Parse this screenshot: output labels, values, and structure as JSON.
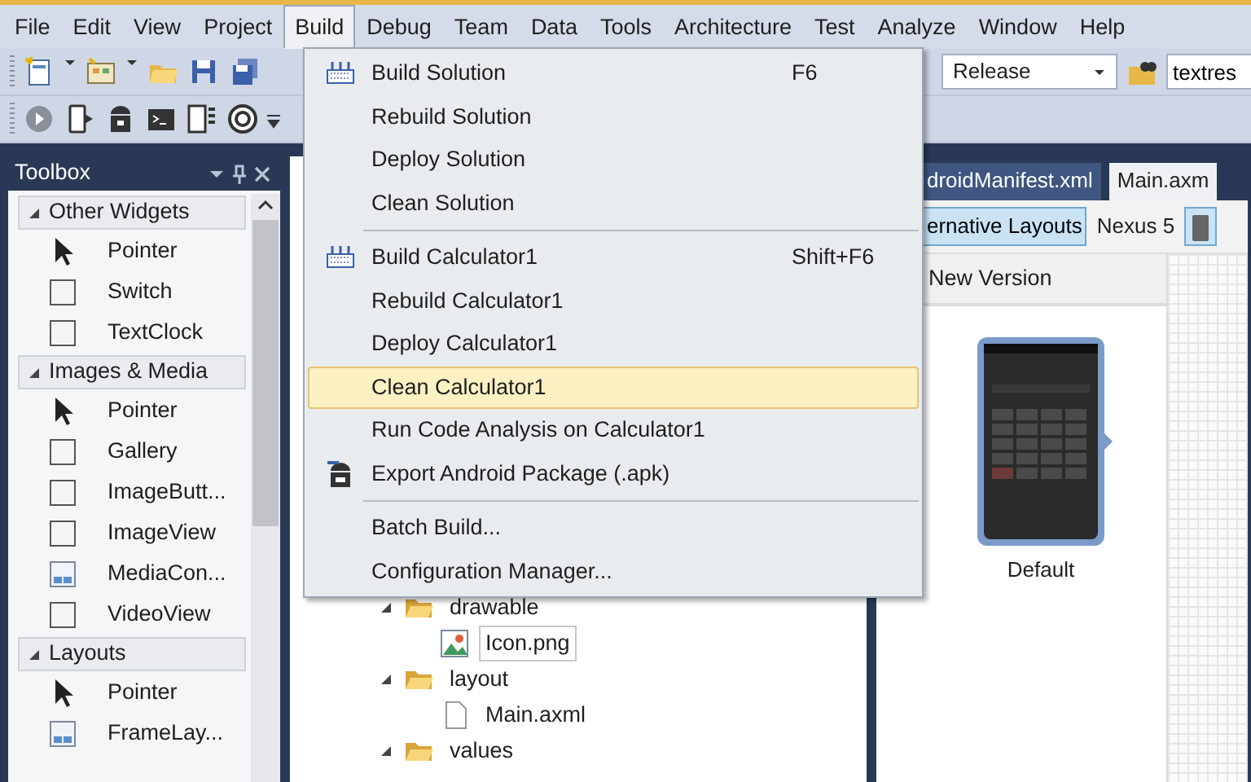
{
  "menu_bar": [
    {
      "label": "File",
      "selected": false
    },
    {
      "label": "Edit",
      "selected": false
    },
    {
      "label": "View",
      "selected": false
    },
    {
      "label": "Project",
      "selected": false
    },
    {
      "label": "Build",
      "selected": true
    },
    {
      "label": "Debug",
      "selected": false
    },
    {
      "label": "Team",
      "selected": false
    },
    {
      "label": "Data",
      "selected": false
    },
    {
      "label": "Tools",
      "selected": false
    },
    {
      "label": "Architecture",
      "selected": false
    },
    {
      "label": "Test",
      "selected": false
    },
    {
      "label": "Analyze",
      "selected": false
    },
    {
      "label": "Window",
      "selected": false
    },
    {
      "label": "Help",
      "selected": false
    }
  ],
  "toolbar": {
    "configuration": "Release",
    "find_value": "textres"
  },
  "toolbox": {
    "title": "Toolbox",
    "groups": [
      {
        "label": "Other Widgets",
        "expanded": true,
        "items": [
          {
            "label": "Pointer",
            "kind": "pointer"
          },
          {
            "label": "Switch",
            "kind": "control"
          },
          {
            "label": "TextClock",
            "kind": "control"
          }
        ]
      },
      {
        "label": "Images & Media",
        "expanded": true,
        "items": [
          {
            "label": "Pointer",
            "kind": "pointer"
          },
          {
            "label": "Gallery",
            "kind": "control"
          },
          {
            "label": "ImageButt...",
            "kind": "control"
          },
          {
            "label": "ImageView",
            "kind": "control"
          },
          {
            "label": "MediaCon...",
            "kind": "form"
          },
          {
            "label": "VideoView",
            "kind": "control"
          }
        ]
      },
      {
        "label": "Layouts",
        "expanded": true,
        "items": [
          {
            "label": "Pointer",
            "kind": "pointer"
          },
          {
            "label": "FrameLay...",
            "kind": "form"
          }
        ]
      }
    ]
  },
  "solution_tree": [
    {
      "label": "drawable",
      "kind": "folder",
      "expanded": true,
      "children": [
        {
          "label": "Icon.png",
          "kind": "image",
          "focused": true
        }
      ]
    },
    {
      "label": "layout",
      "kind": "folder",
      "expanded": true,
      "children": [
        {
          "label": "Main.axml",
          "kind": "file"
        }
      ]
    },
    {
      "label": "values",
      "kind": "folder",
      "expanded": true
    }
  ],
  "designer": {
    "tabs": [
      {
        "label": "droidManifest.xml",
        "selected": false
      },
      {
        "label": "Main.axm",
        "selected": true
      }
    ],
    "alternative_layouts": {
      "label": "ernative Layouts",
      "on": true
    },
    "device": "Nexus 5",
    "version_header": "New Version",
    "preview_label": "Default"
  },
  "build_menu": {
    "sections": [
      [
        {
          "label": "Build Solution",
          "shortcut": "F6",
          "kind": "build",
          "selected": false
        },
        {
          "label": "Rebuild Solution",
          "selected": false
        },
        {
          "label": "Deploy Solution",
          "selected": false
        },
        {
          "label": "Clean Solution",
          "selected": false
        }
      ],
      [
        {
          "label": "Build Calculator1",
          "shortcut": "Shift+F6",
          "kind": "build",
          "selected": false
        },
        {
          "label": "Rebuild Calculator1",
          "selected": false
        },
        {
          "label": "Deploy Calculator1",
          "selected": false
        },
        {
          "label": "Clean Calculator1",
          "selected": true
        },
        {
          "label": "Run Code Analysis on Calculator1",
          "selected": false
        },
        {
          "label": "Export Android Package (.apk)",
          "kind": "package",
          "selected": false
        }
      ],
      [
        {
          "label": "Batch Build...",
          "selected": false
        },
        {
          "label": "Configuration Manager...",
          "selected": false
        }
      ]
    ]
  }
}
